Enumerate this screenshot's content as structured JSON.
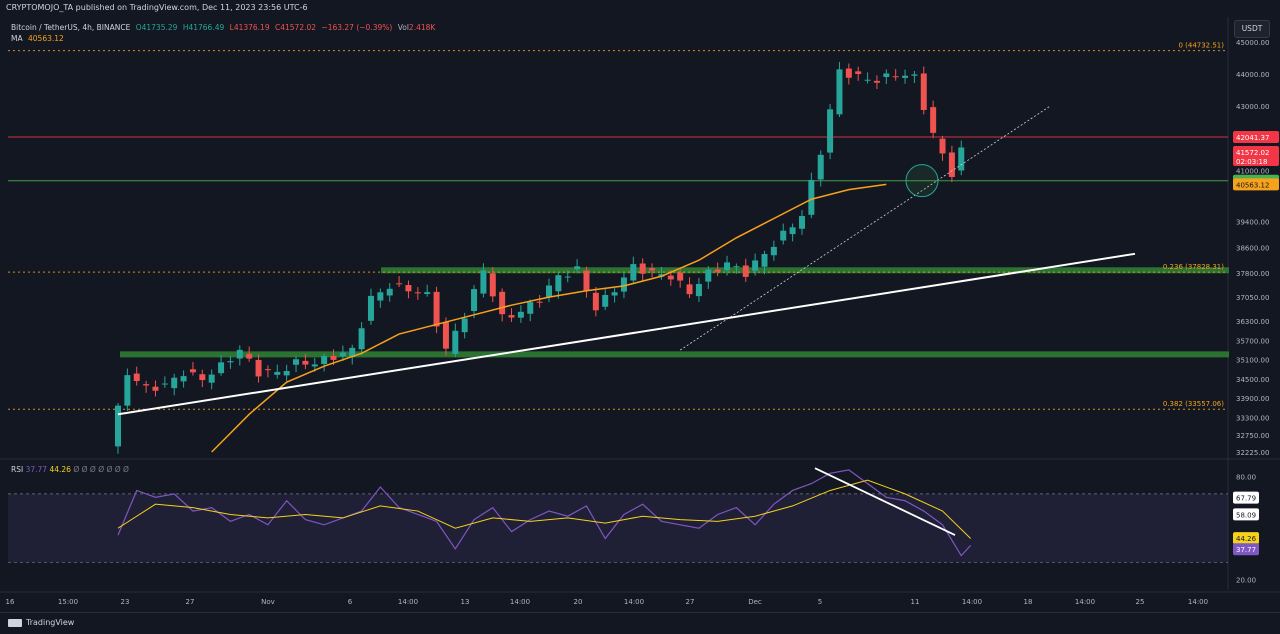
{
  "publisher": "CRYPTOMOJO_TA published on TradingView.com, Dec 11, 2023 23:56 UTC-6",
  "symbol": "Bitcoin / TetherUS, 4h, BINANCE",
  "ohlc": {
    "o": "O41735.29",
    "h": "H41766.49",
    "l": "L41376.19",
    "c": "C41572.02",
    "chg": "−163.27 (−0.39%)",
    "vol_label": "Vol",
    "vol": "2.418K"
  },
  "ma": {
    "label": "MA",
    "value": "40563.12"
  },
  "currency": "USDT",
  "rsi": {
    "label": "RSI",
    "v1": "37.77",
    "v2": "44.26",
    "extras": "Ø Ø Ø Ø Ø Ø Ø"
  },
  "footer": "TradingView",
  "chart_data": [
    {
      "type": "candlestick",
      "title": "Bitcoin / TetherUS, 4h, BINANCE",
      "ylim": [
        32225,
        45000
      ],
      "y_ticks": [
        "45000.00",
        "44000.00",
        "43000.00",
        "42041.37",
        "41572.02",
        "41000.00",
        "40676.31",
        "40563.12",
        "39400.00",
        "38600.00",
        "37800.00",
        "37050.00",
        "36300.00",
        "35700.00",
        "35100.00",
        "34500.00",
        "33900.00",
        "33300.00",
        "32750.00",
        "32225.00"
      ],
      "x_ticks": [
        "16",
        "15:00",
        "23",
        "27",
        "Nov",
        "6",
        "14:00",
        "13",
        "14:00",
        "20",
        "14:00",
        "27",
        "Dec",
        "5",
        "11",
        "14:00",
        "18",
        "14:00",
        "25",
        "14:00"
      ],
      "price_path": [
        [
          0,
          32400
        ],
        [
          2,
          34700
        ],
        [
          4,
          34200
        ],
        [
          6,
          34300
        ],
        [
          8,
          34700
        ],
        [
          10,
          34500
        ],
        [
          12,
          34900
        ],
        [
          14,
          35400
        ],
        [
          16,
          34700
        ],
        [
          18,
          34700
        ],
        [
          20,
          35000
        ],
        [
          22,
          35000
        ],
        [
          24,
          35200
        ],
        [
          26,
          35400
        ],
        [
          28,
          37000
        ],
        [
          30,
          37400
        ],
        [
          32,
          37300
        ],
        [
          34,
          37100
        ],
        [
          36,
          35400
        ],
        [
          38,
          36500
        ],
        [
          40,
          37900
        ],
        [
          42,
          36400
        ],
        [
          44,
          36600
        ],
        [
          46,
          37000
        ],
        [
          48,
          37700
        ],
        [
          50,
          37900
        ],
        [
          52,
          36700
        ],
        [
          54,
          37300
        ],
        [
          56,
          38000
        ],
        [
          58,
          37800
        ],
        [
          60,
          37700
        ],
        [
          62,
          37200
        ],
        [
          64,
          37800
        ],
        [
          66,
          38100
        ],
        [
          68,
          37800
        ],
        [
          70,
          38400
        ],
        [
          72,
          39000
        ],
        [
          74,
          39600
        ],
        [
          76,
          41600
        ],
        [
          78,
          44100
        ],
        [
          80,
          43900
        ],
        [
          82,
          43800
        ],
        [
          84,
          44000
        ],
        [
          86,
          43900
        ],
        [
          88,
          42100
        ],
        [
          90,
          40900
        ],
        [
          91,
          41600
        ]
      ],
      "ma_path": [
        [
          10,
          32225
        ],
        [
          14,
          33400
        ],
        [
          18,
          34400
        ],
        [
          22,
          34900
        ],
        [
          26,
          35300
        ],
        [
          30,
          35900
        ],
        [
          34,
          36200
        ],
        [
          38,
          36500
        ],
        [
          42,
          36800
        ],
        [
          46,
          37050
        ],
        [
          50,
          37250
        ],
        [
          54,
          37400
        ],
        [
          58,
          37700
        ],
        [
          62,
          38200
        ],
        [
          66,
          38900
        ],
        [
          70,
          39500
        ],
        [
          74,
          40100
        ],
        [
          78,
          40400
        ],
        [
          82,
          40563
        ]
      ],
      "levels": [
        {
          "label": "0 (44732.51)",
          "price": 44732.51,
          "color": "#f7a21b"
        },
        {
          "label": "0.236 (37828.31)",
          "price": 37828.31,
          "color": "#f7a21b"
        },
        {
          "label": "0.382 (33557.06)",
          "price": 33557.06,
          "color": "#f7a21b"
        },
        {
          "label": "42041.37",
          "price": 42041.37,
          "color": "#f23645"
        },
        {
          "label": "40676.31",
          "price": 40676.31,
          "color": "#4caf50"
        }
      ],
      "zones": [
        {
          "from": 37800,
          "to": 37980
        },
        {
          "from": 35180,
          "to": 35360
        }
      ],
      "price_labels": [
        {
          "text": "42041.37",
          "sub": "",
          "bg": "#f23645",
          "fg": "#ffffff",
          "price": 42041.37
        },
        {
          "text": "41572.02",
          "sub": "02:03:18",
          "bg": "#f23645",
          "fg": "#ffffff",
          "price": 41572.02
        },
        {
          "text": "40676.31",
          "sub": "",
          "bg": "#4caf50",
          "fg": "#ffffff",
          "price": 40676.31
        },
        {
          "text": "40563.12",
          "sub": "",
          "bg": "#f7a21b",
          "fg": "#131722",
          "price": 40563.12
        }
      ]
    },
    {
      "type": "line",
      "title": "RSI",
      "ylim": [
        14,
        88
      ],
      "y_ticks": [
        "80.00",
        "67.79",
        "58.09",
        "44.26",
        "37.77",
        "20.00"
      ],
      "band": [
        30,
        70
      ],
      "rsi_path": [
        [
          0,
          46
        ],
        [
          2,
          72
        ],
        [
          4,
          68
        ],
        [
          6,
          70
        ],
        [
          8,
          60
        ],
        [
          10,
          62
        ],
        [
          12,
          54
        ],
        [
          14,
          58
        ],
        [
          16,
          52
        ],
        [
          18,
          66
        ],
        [
          20,
          55
        ],
        [
          22,
          52
        ],
        [
          24,
          56
        ],
        [
          26,
          60
        ],
        [
          28,
          74
        ],
        [
          30,
          62
        ],
        [
          32,
          58
        ],
        [
          34,
          54
        ],
        [
          36,
          38
        ],
        [
          38,
          55
        ],
        [
          40,
          62
        ],
        [
          42,
          48
        ],
        [
          44,
          55
        ],
        [
          46,
          60
        ],
        [
          48,
          57
        ],
        [
          50,
          63
        ],
        [
          52,
          44
        ],
        [
          54,
          58
        ],
        [
          56,
          64
        ],
        [
          58,
          54
        ],
        [
          60,
          52
        ],
        [
          62,
          50
        ],
        [
          64,
          58
        ],
        [
          66,
          62
        ],
        [
          68,
          52
        ],
        [
          70,
          64
        ],
        [
          72,
          72
        ],
        [
          74,
          76
        ],
        [
          76,
          82
        ],
        [
          78,
          84
        ],
        [
          80,
          76
        ],
        [
          82,
          68
        ],
        [
          84,
          66
        ],
        [
          86,
          60
        ],
        [
          88,
          52
        ],
        [
          90,
          34
        ],
        [
          91,
          40
        ]
      ],
      "signal_path": [
        [
          0,
          50
        ],
        [
          4,
          64
        ],
        [
          8,
          62
        ],
        [
          12,
          58
        ],
        [
          16,
          56
        ],
        [
          20,
          58
        ],
        [
          24,
          56
        ],
        [
          28,
          63
        ],
        [
          32,
          60
        ],
        [
          36,
          50
        ],
        [
          40,
          56
        ],
        [
          44,
          54
        ],
        [
          48,
          56
        ],
        [
          52,
          53
        ],
        [
          56,
          57
        ],
        [
          60,
          55
        ],
        [
          64,
          54
        ],
        [
          68,
          57
        ],
        [
          72,
          63
        ],
        [
          76,
          72
        ],
        [
          80,
          78
        ],
        [
          84,
          70
        ],
        [
          88,
          60
        ],
        [
          91,
          44
        ]
      ],
      "price_labels": [
        {
          "text": "67.79",
          "bg": "#ffffff",
          "fg": "#131722",
          "value": 67.79
        },
        {
          "text": "58.09",
          "bg": "#ffffff",
          "fg": "#131722",
          "value": 58.09
        },
        {
          "text": "44.26",
          "bg": "#f7d21b",
          "fg": "#131722",
          "value": 44.26
        },
        {
          "text": "37.77",
          "bg": "#7e57c2",
          "fg": "#ffffff",
          "value": 37.77
        }
      ]
    }
  ],
  "colors": {
    "bg": "#131722",
    "up": "#26a69a",
    "down": "#ef5350",
    "ma": "#f7a21b",
    "rsi": "#7e57c2",
    "signal": "#f7d21b",
    "zone": "#2e7d32",
    "trend": "#ffffff"
  }
}
